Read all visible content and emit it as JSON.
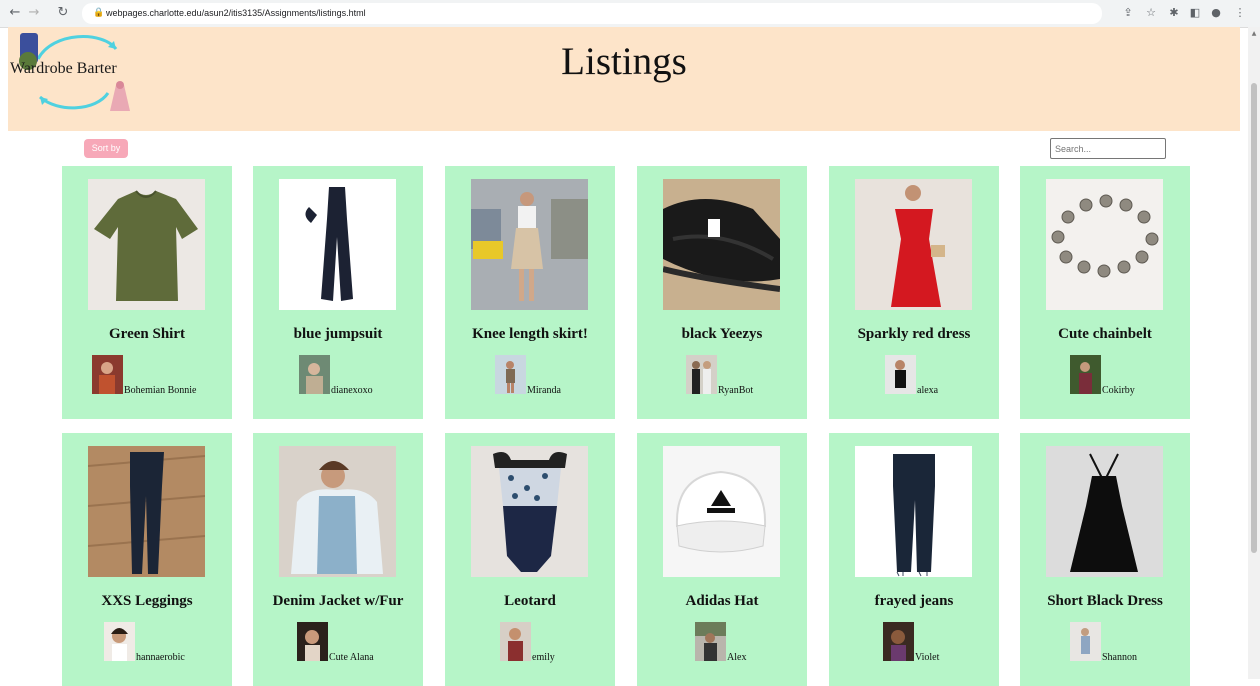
{
  "browser": {
    "url": "webpages.charlotte.edu/asun2/itis3135/Assignments/listings.html"
  },
  "header": {
    "logo_text": "Wardrobe Barter",
    "title": "Listings",
    "background": "#fde4c9"
  },
  "controls": {
    "sort_label": "Sort by",
    "search_placeholder": "Search..."
  },
  "listings": [
    {
      "title": "Green Shirt",
      "seller": "Bohemian Bonnie"
    },
    {
      "title": "blue jumpsuit",
      "seller": "dianexoxo"
    },
    {
      "title": "Knee length skirt!",
      "seller": "Miranda"
    },
    {
      "title": "black Yeezys",
      "seller": "RyanBot"
    },
    {
      "title": "Sparkly red dress",
      "seller": "alexa"
    },
    {
      "title": "Cute chainbelt",
      "seller": "Cokirby"
    },
    {
      "title": "XXS Leggings",
      "seller": "hannaerobic"
    },
    {
      "title": "Denim Jacket w/Fur",
      "seller": "Cute Alana"
    },
    {
      "title": "Leotard",
      "seller": "emily"
    },
    {
      "title": "Adidas Hat",
      "seller": "Alex"
    },
    {
      "title": "frayed jeans",
      "seller": "Violet"
    },
    {
      "title": "Short Black Dress",
      "seller": "Shannon"
    }
  ],
  "colors": {
    "card_background": "#b6f5c8",
    "sort_button": "#f7a8b8",
    "header_background": "#fde4c9"
  }
}
